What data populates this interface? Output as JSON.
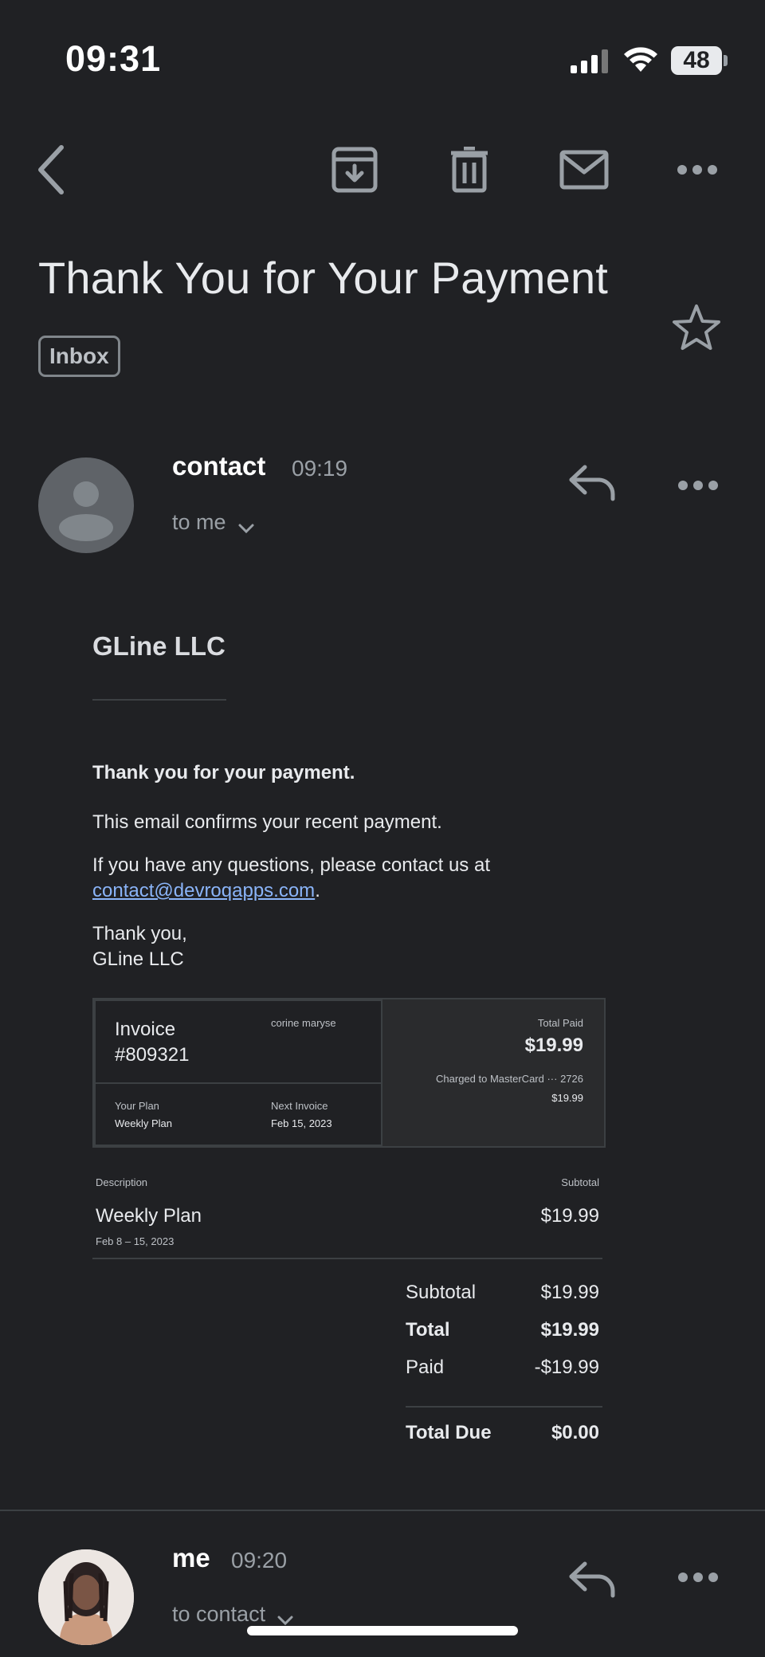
{
  "status_bar": {
    "time": "09:31",
    "battery": "48"
  },
  "toolbar": {
    "back": "back",
    "archive": "archive",
    "delete": "delete",
    "mark_unread": "mark unread",
    "more": "more"
  },
  "email": {
    "subject": "Thank You for Your Payment",
    "label": "Inbox"
  },
  "message1": {
    "sender": "contact",
    "time": "09:19",
    "recipient": "to me"
  },
  "body": {
    "company": "GLine LLC",
    "heading": "Thank you for your payment.",
    "confirm": "This email confirms your recent payment.",
    "questions": "If you have any questions, please contact us at",
    "email_link": "contact@devroqapps.com",
    "period": ".",
    "thanks": "Thank you,",
    "signature": "GLine LLC"
  },
  "invoice": {
    "label": "Invoice",
    "number": "#809321",
    "customer": "corine maryse",
    "total_paid_label": "Total Paid",
    "total_paid": "$19.99",
    "charged": "Charged to MasterCard ··· 2726",
    "charged_amount": "$19.99",
    "plan_label": "Your Plan",
    "plan": "Weekly Plan",
    "next_label": "Next Invoice",
    "next_date": "Feb 15, 2023"
  },
  "line_items": {
    "col_description": "Description",
    "col_subtotal": "Subtotal",
    "items": [
      {
        "name": "Weekly Plan",
        "period": "Feb 8 – 15, 2023",
        "amount": "$19.99"
      }
    ]
  },
  "totals": {
    "subtotal_label": "Subtotal",
    "subtotal": "$19.99",
    "total_label": "Total",
    "total": "$19.99",
    "paid_label": "Paid",
    "paid": "-$19.99",
    "due_label": "Total Due",
    "due": "$0.00"
  },
  "message2": {
    "sender": "me",
    "time": "09:20",
    "recipient": "to contact"
  },
  "colors": {
    "background": "#202124",
    "text": "#e8eaed",
    "link": "#8ab4f8"
  }
}
